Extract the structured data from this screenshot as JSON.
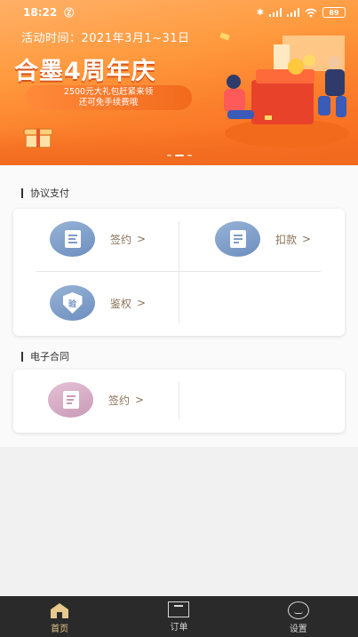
{
  "status_bar": {
    "time": "18:22",
    "mute_glyph": "Ⓩ",
    "bluetooth_glyph": "✱",
    "battery": "89"
  },
  "banner": {
    "date": "活动时间：2021年3月1~31日",
    "title": "合墨4周年庆",
    "subtitle_line1": "2500元大礼包赶紧来领",
    "subtitle_line2": "还可免手续费哦"
  },
  "sections": {
    "agreement_pay": {
      "title": "协议支付",
      "items": [
        {
          "label": "签约",
          "chevron": ">",
          "icon": "document-icon"
        },
        {
          "label": "扣款",
          "chevron": ">",
          "icon": "receipt-icon"
        },
        {
          "label": "鉴权",
          "chevron": ">",
          "icon": "verify-shield-icon",
          "icon_text": "验"
        }
      ]
    },
    "e_contract": {
      "title": "电子合同",
      "items": [
        {
          "label": "签约",
          "chevron": ">",
          "icon": "contract-sign-icon"
        }
      ]
    }
  },
  "tabbar": {
    "tabs": [
      {
        "label": "首页",
        "icon": "home-icon",
        "active": true
      },
      {
        "label": "订单",
        "icon": "order-icon",
        "active": false
      },
      {
        "label": "设置",
        "icon": "settings-icon",
        "active": false
      }
    ]
  },
  "colors": {
    "accent_gold": "#e6c98c",
    "label_brown": "#8b7358",
    "banner_orange": "#fb7d2a",
    "icon_blue": "#7f9cc8",
    "icon_pink": "#c99ab6",
    "tabbar_bg": "#2a2a2a"
  }
}
